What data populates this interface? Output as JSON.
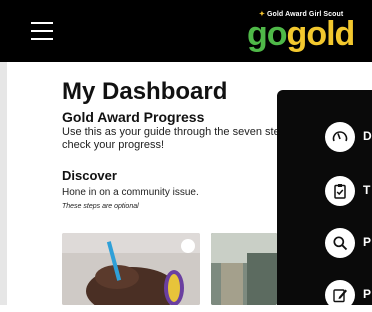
{
  "header": {
    "logo_tagline": "Gold Award Girl Scout",
    "logo_go": "go",
    "logo_gold": "gold"
  },
  "main": {
    "title": "My Dashboard",
    "subtitle": "Gold Award Progress",
    "intro": "Use this as your guide through the seven steps check your progress!",
    "section_title": "Discover",
    "section_desc": "Hone in on a community issue.",
    "section_note": "These steps are optional"
  },
  "side_menu": {
    "items": [
      {
        "icon": "gauge-icon",
        "label": "D"
      },
      {
        "icon": "clipboard-check-icon",
        "label": "T"
      },
      {
        "icon": "search-icon",
        "label": "P"
      },
      {
        "icon": "edit-icon",
        "label": "P"
      }
    ]
  },
  "colors": {
    "topbar": "#000000",
    "logo_go": "#4fb848",
    "logo_gold": "#f3c82e",
    "panel": "#0a0a0a"
  }
}
